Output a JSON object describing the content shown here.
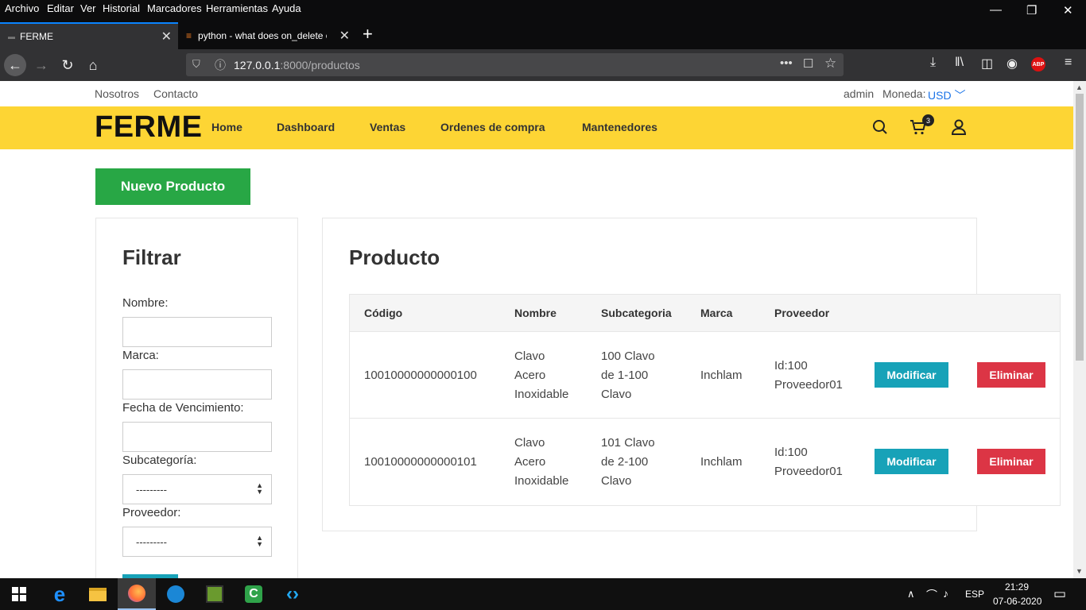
{
  "browser": {
    "menu": [
      "Archivo",
      "Editar",
      "Ver",
      "Historial",
      "Marcadores",
      "Herramientas",
      "Ayuda"
    ],
    "tabs": [
      {
        "title": "FERME"
      },
      {
        "title": "python - what does on_delete o"
      }
    ],
    "url_host": "127.0.0.1",
    "url_path": ":8000/productos"
  },
  "topbar": {
    "links": [
      "Nosotros",
      "Contacto"
    ],
    "user": "admin",
    "currency_label": "Moneda:",
    "currency_value": "USD"
  },
  "header": {
    "logo": "FERME",
    "nav": [
      "Home",
      "Dashboard",
      "Ventas",
      "Ordenes de compra",
      "Mantenedores"
    ],
    "cart_count": "3"
  },
  "main": {
    "new_button": "Nuevo Producto",
    "filter": {
      "title": "Filtrar",
      "labels": [
        "Nombre:",
        "Marca:",
        "Fecha de Vencimiento:",
        "Subcategoría:",
        "Proveedor:"
      ],
      "subcategoria_value": "---------",
      "proveedor_value": "---------"
    },
    "products": {
      "title": "Producto",
      "columns": [
        "Código",
        "Nombre",
        "Subcategoria",
        "Marca",
        "Proveedor"
      ],
      "rows": [
        {
          "codigo": "10010000000000100",
          "nombre": [
            "Clavo",
            "Acero",
            "Inoxidable"
          ],
          "subcategoria": [
            "100 Clavo",
            "de 1-100",
            "Clavo"
          ],
          "marca": "Inchlam",
          "proveedor": [
            "Id:100",
            "Proveedor01"
          ]
        },
        {
          "codigo": "10010000000000101",
          "nombre": [
            "Clavo",
            "Acero",
            "Inoxidable"
          ],
          "subcategoria": [
            "101 Clavo",
            "de 2-100",
            "Clavo"
          ],
          "marca": "Inchlam",
          "proveedor": [
            "Id:100",
            "Proveedor01"
          ]
        }
      ],
      "modify_label": "Modificar",
      "delete_label": "Eliminar"
    }
  },
  "taskbar": {
    "lang": "ESP",
    "time": "21:29",
    "date": "07-06-2020"
  }
}
